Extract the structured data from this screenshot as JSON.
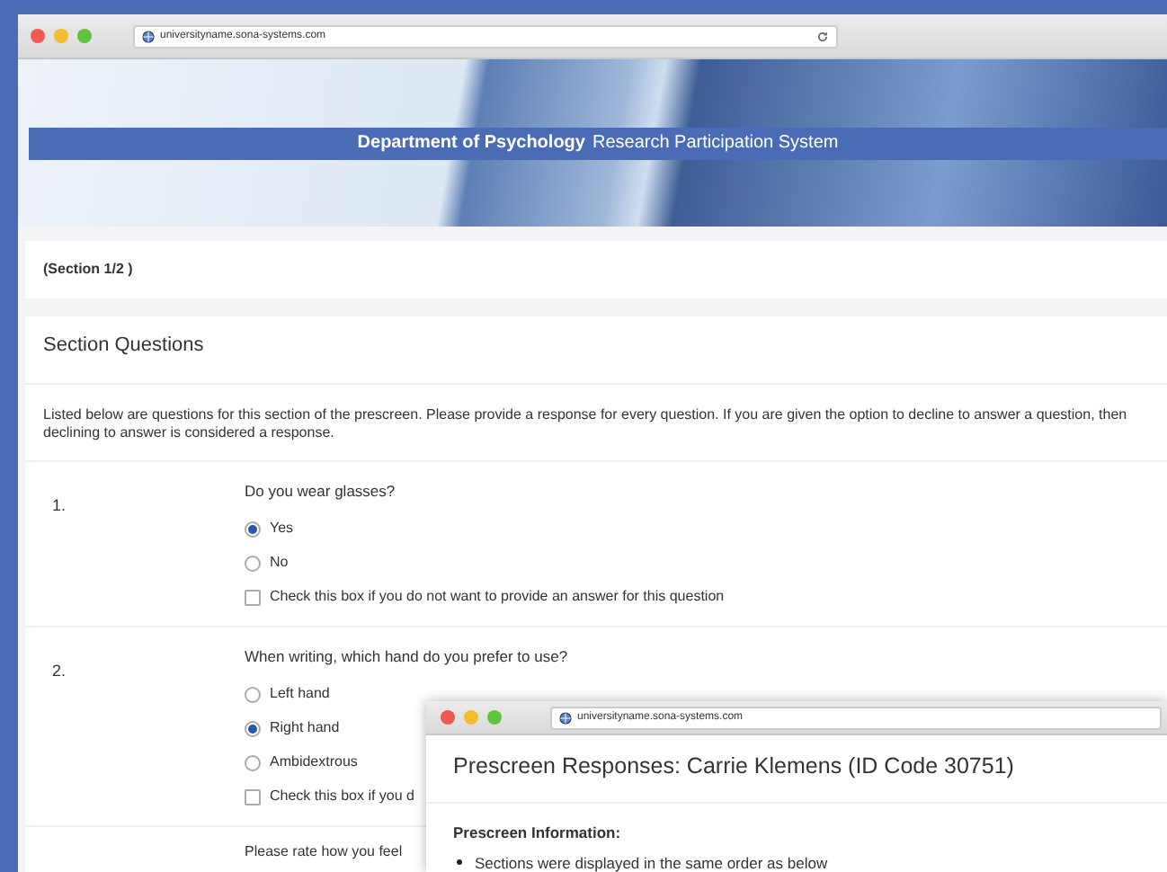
{
  "browser": {
    "url": "universityname.sona-systems.com"
  },
  "banner": {
    "title_bold": "Department of Psychology",
    "title_rest": "Research Participation System"
  },
  "section_label": "(Section 1/2 )",
  "section_heading": "Section Questions",
  "intro": "Listed below are questions for this section of the prescreen. Please provide a response for every question. If you are given the option to decline to answer a question, then declining to answer is considered a response.",
  "questions": [
    {
      "number": "1.",
      "text": "Do you wear glasses?",
      "options": [
        {
          "label": "Yes",
          "selected": true
        },
        {
          "label": "No",
          "selected": false
        }
      ],
      "decline": {
        "label": "Check this box if you do not want to provide an answer for this question",
        "checked": false
      }
    },
    {
      "number": "2.",
      "text": "When writing, which hand do you prefer to use?",
      "options": [
        {
          "label": "Left hand",
          "selected": false
        },
        {
          "label": "Right hand",
          "selected": true
        },
        {
          "label": "Ambidextrous",
          "selected": false
        }
      ],
      "decline": {
        "label": "Check this box if you d",
        "checked": false
      }
    }
  ],
  "partial_question": {
    "text": "Please rate how you feel"
  },
  "popup": {
    "url": "universityname.sona-systems.com",
    "title": "Prescreen Responses: Carrie Klemens (ID Code 30751)",
    "info_heading": "Prescreen Information:",
    "bullets": [
      "Sections were displayed in the same order as below"
    ]
  }
}
